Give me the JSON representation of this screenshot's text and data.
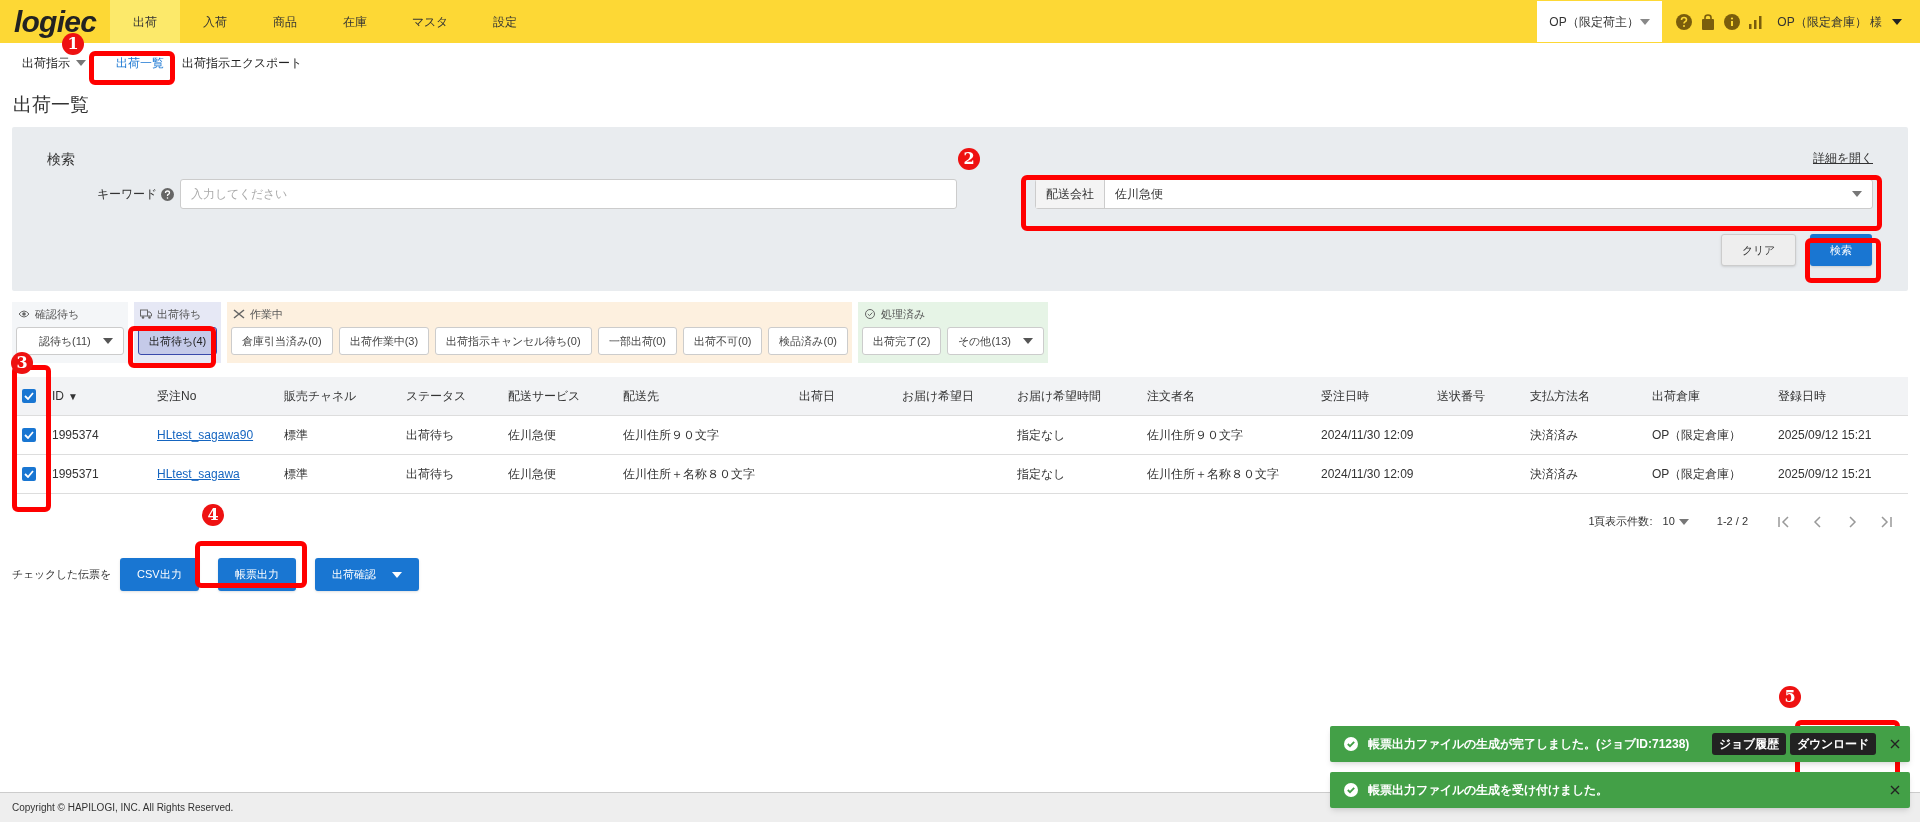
{
  "header": {
    "logo": "logiec",
    "nav": [
      {
        "label": "出荷",
        "selected": true
      },
      {
        "label": "入荷",
        "selected": false
      },
      {
        "label": "商品",
        "selected": false
      },
      {
        "label": "在庫",
        "selected": false
      },
      {
        "label": "マスタ",
        "selected": false
      },
      {
        "label": "設定",
        "selected": false
      }
    ],
    "shipper_select": "OP（限定荷主）",
    "user": "OP（限定倉庫） 様"
  },
  "subnav": [
    {
      "label": "出荷指示",
      "kind": "dropdown",
      "selected": false
    },
    {
      "label": "出荷一覧",
      "kind": "link",
      "selected": true
    },
    {
      "label": "出荷指示エクスポート",
      "kind": "link",
      "selected": false
    }
  ],
  "page_title": "出荷一覧",
  "search": {
    "title": "検索",
    "expand_link": "詳細を開く",
    "keyword_label": "キーワード",
    "keyword_placeholder": "入力してください",
    "carrier_label": "配送会社",
    "carrier_value": "佐川急便",
    "buttons": [
      {
        "label": "クリア",
        "kind": "secondary"
      },
      {
        "label": "検索",
        "kind": "primary"
      }
    ]
  },
  "status_groups": [
    {
      "label": "確認待ち",
      "kind": "eye",
      "tabs": [
        {
          "label": "認待ち(11)",
          "selected": false,
          "dropdown": true
        }
      ]
    },
    {
      "label": "出荷待ち",
      "kind": "truck",
      "tabs": [
        {
          "label": "出荷待ち(4)",
          "selected": true,
          "dropdown": false
        }
      ]
    },
    {
      "label": "作業中",
      "kind": "tools",
      "tabs": [
        {
          "label": "倉庫引当済み(0)",
          "selected": false,
          "dropdown": false
        },
        {
          "label": "出荷作業中(3)",
          "selected": false,
          "dropdown": false
        },
        {
          "label": "出荷指示キャンセル待ち(0)",
          "selected": false,
          "dropdown": false
        },
        {
          "label": "一部出荷(0)",
          "selected": false,
          "dropdown": false
        },
        {
          "label": "出荷不可(0)",
          "selected": false,
          "dropdown": false
        },
        {
          "label": "検品済み(0)",
          "selected": false,
          "dropdown": false
        }
      ]
    },
    {
      "label": "処理済み",
      "kind": "done",
      "tabs": [
        {
          "label": "出荷完了(2)",
          "selected": false,
          "dropdown": false
        },
        {
          "label": "その他(13)",
          "selected": false,
          "dropdown": true
        }
      ]
    }
  ],
  "table": {
    "header_checked": true,
    "columns": [
      {
        "label": "ID",
        "sort_mark": "▼"
      },
      {
        "label": "受注No"
      },
      {
        "label": "販売チャネル"
      },
      {
        "label": "ステータス"
      },
      {
        "label": "配送サービス"
      },
      {
        "label": "配送先"
      },
      {
        "label": "出荷日"
      },
      {
        "label": "お届け希望日"
      },
      {
        "label": "お届け希望時間"
      },
      {
        "label": "注文者名"
      },
      {
        "label": "受注日時"
      },
      {
        "label": "送状番号"
      },
      {
        "label": "支払方法名"
      },
      {
        "label": "出荷倉庫"
      },
      {
        "label": "登録日時"
      }
    ],
    "rows": [
      {
        "checked": true,
        "id": "1995374",
        "order_no": "HLtest_sagawa90",
        "channel": "標準",
        "status": "出荷待ち",
        "service": "佐川急便",
        "destination": "佐川住所９０文字",
        "delivery_time": "指定なし",
        "orderer": "佐川住所９０文字",
        "order_date": "2024/11/30 12:09",
        "payment": "決済済み",
        "warehouse": "OP（限定倉庫）",
        "registered": "2025/09/12 15:21"
      },
      {
        "checked": true,
        "id": "1995371",
        "order_no": "HLtest_sagawa",
        "channel": "標準",
        "status": "出荷待ち",
        "service": "佐川急便",
        "destination": "佐川住所＋名称８０文字",
        "delivery_time": "指定なし",
        "orderer": "佐川住所＋名称８０文字",
        "order_date": "2024/11/30 12:09",
        "payment": "決済済み",
        "warehouse": "OP（限定倉庫）",
        "registered": "2025/09/12 15:21"
      }
    ]
  },
  "pagination": {
    "per_page_label": "1頁表示件数:",
    "per_page": "10",
    "range": "1-2 / 2"
  },
  "bulk_actions": {
    "label": "チェックした伝票を",
    "buttons": [
      {
        "label": "CSV出力",
        "dropdown": false
      },
      {
        "label": "帳票出力",
        "dropdown": false
      },
      {
        "label": "出荷確認",
        "dropdown": true
      }
    ]
  },
  "toasts": [
    {
      "message": "帳票出力ファイルの生成が完了しました。(ジョブID:71238)",
      "actions": [
        "ジョブ履歴",
        "ダウンロード"
      ]
    },
    {
      "message": "帳票出力ファイルの生成を受け付けました。"
    }
  ],
  "footer": "Copyright © HAPILOGI, INC. All Rights Reserved.",
  "annotations": [
    {
      "label": "1"
    },
    {
      "label": "2"
    },
    {
      "label": "3"
    },
    {
      "label": "4"
    },
    {
      "label": "5"
    }
  ]
}
